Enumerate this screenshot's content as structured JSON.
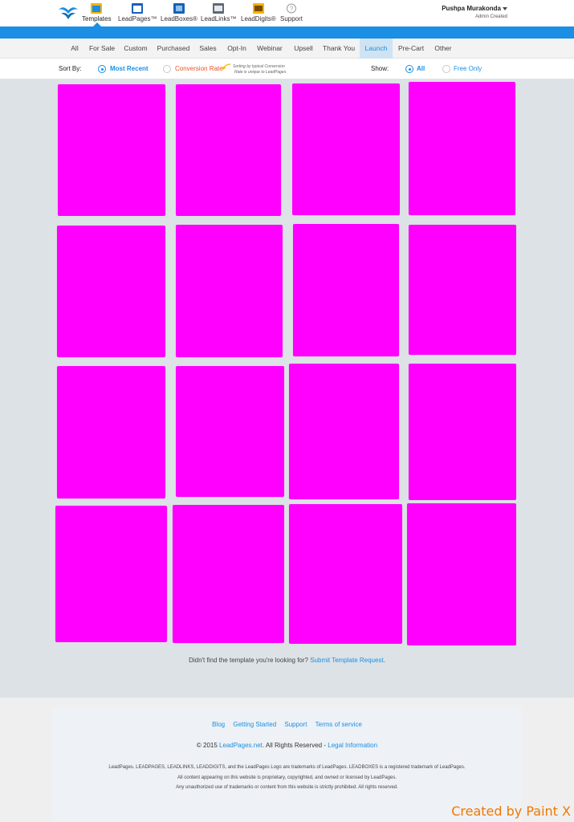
{
  "header": {
    "nav": [
      {
        "label": "Templates",
        "icon": "templates-icon",
        "active": true
      },
      {
        "label": "LeadPages™",
        "icon": "leadpages-icon"
      },
      {
        "label": "LeadBoxes®",
        "icon": "leadboxes-icon"
      },
      {
        "label": "LeadLinks™",
        "icon": "leadlinks-icon"
      },
      {
        "label": "LeadDigits®",
        "icon": "leaddigits-icon"
      },
      {
        "label": "Support",
        "icon": "question-icon"
      }
    ],
    "user_name": "Pushpa Murakonda",
    "user_role": "Admin Created"
  },
  "tabs": [
    "All",
    "For Sale",
    "Custom",
    "Purchased",
    "Sales",
    "Opt-In",
    "Webinar",
    "Upsell",
    "Thank You",
    "Launch",
    "Pre-Cart",
    "Other"
  ],
  "active_tab": "Launch",
  "sort": {
    "label": "Sort By:",
    "most_recent": "Most Recent",
    "conversion_rate": "Conversion Rate",
    "note_line1": "Sorting by typical Conversion",
    "note_line2": "Rate is unique to LeadPages",
    "selected": "Most Recent"
  },
  "show": {
    "label": "Show:",
    "all": "All",
    "free_only": "Free Only",
    "selected": "All"
  },
  "template_count": 16,
  "template_color": "#ff00ff",
  "request": {
    "text": "Didn't find the template you're looking for? ",
    "link": "Submit Template Request",
    "end": "."
  },
  "footer": {
    "links": [
      "Blog",
      "Getting Started",
      "Support",
      "Terms of service"
    ],
    "copyright_prefix": "© 2015 ",
    "copyright_link": "LeadPages.net",
    "copyright_mid": ". All Rights Reserved - ",
    "legal_link": "Legal Information",
    "legal_lines": [
      "LeadPages. LEADPAGES, LEADLINKS, LEADDIGITS, and the LeadPages Logo are trademarks of LeadPages. LEADBOXES is a registered trademark of LeadPages.",
      "All content appearing on this website is proprietary, copyrighted, and owned or licensed by LeadPages.",
      "Any unauthorized use of trademarks or content from this website is strictly prohibited. All rights reserved."
    ]
  },
  "watermark": "Created by Paint X",
  "colors": {
    "accent": "#1a8fe3",
    "tile": "#ff00ff",
    "grid_bg": "#dde2e6"
  }
}
